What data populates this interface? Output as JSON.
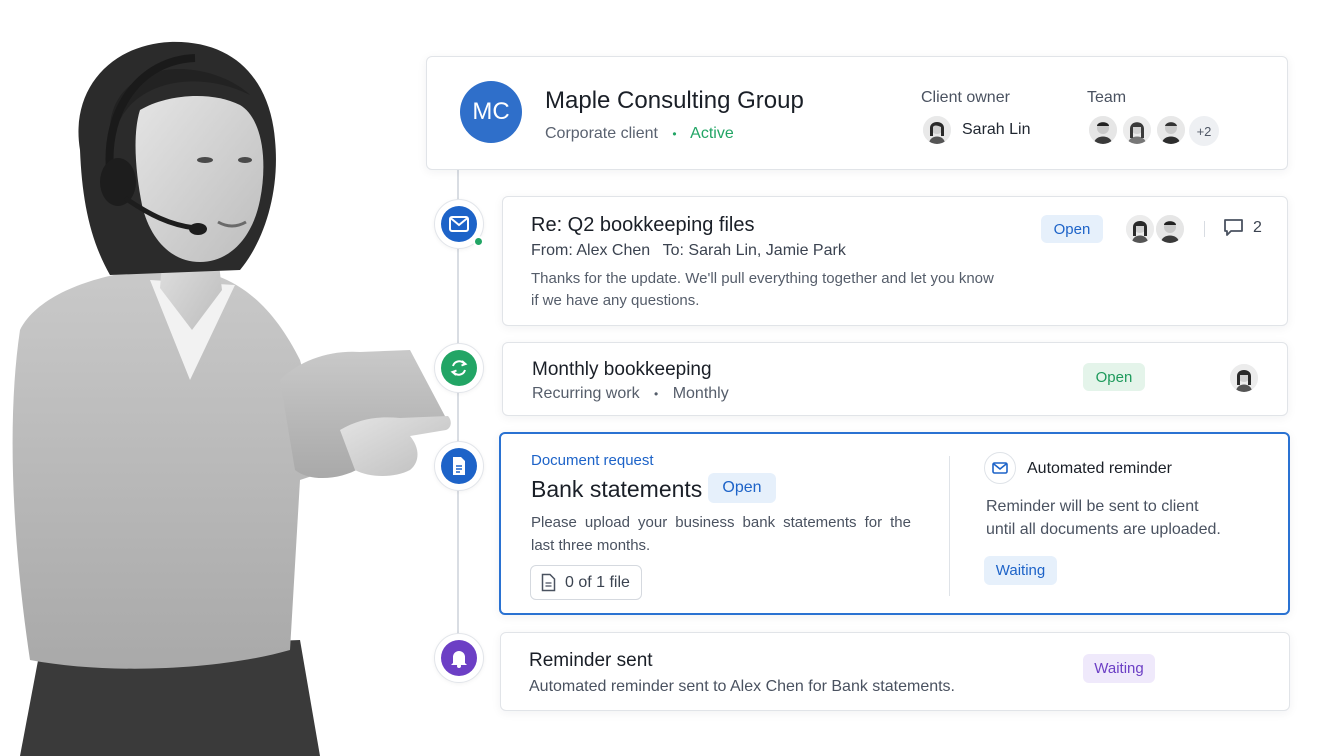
{
  "client": {
    "initials": "MC",
    "name": "Maple Consulting Group",
    "type": "Corporate client",
    "separator": "•",
    "status": "Active",
    "owner_label": "Client owner",
    "owner_name": "Sarah Lin",
    "team_label": "Team",
    "team_extra": "+2"
  },
  "email_item": {
    "icon": "mail-icon",
    "subject": "Re: Q2 bookkeeping files",
    "from_label": "From:",
    "from_name": "Alex Chen",
    "to_label": "To:",
    "to_names": "Sarah Lin, Jamie Park",
    "preview": "Thanks for the update. We'll pull everything together and let you know if we have any questions.",
    "status": "Open",
    "comment_count": "2"
  },
  "recurring_item": {
    "icon": "refresh-icon",
    "title": "Monthly bookkeeping",
    "kind": "Recurring work",
    "separator": "•",
    "frequency": "Monthly",
    "status": "Open"
  },
  "document_item": {
    "icon": "document-icon",
    "eyebrow": "Document request",
    "title": "Bank statements",
    "status": "Open",
    "description": "Please upload your business bank statements for the last three months.",
    "file_count": "0 of 1 file",
    "reminder_title": "Automated reminder",
    "reminder_text": "Reminder will be sent to client until all documents are uploaded.",
    "reminder_status": "Waiting"
  },
  "reminder_item": {
    "icon": "bell-icon",
    "title": "Reminder sent",
    "description": "Automated reminder sent to Alex Chen for Bank statements.",
    "status": "Waiting"
  },
  "colors": {
    "primary_blue": "#1d63c8",
    "open_blue_bg": "#e6f0fb",
    "green": "#22a565",
    "open_green_bg": "#e4f4ea",
    "purple": "#6c3fc5",
    "waiting_purple_bg": "#efe9fb",
    "waiting_blue_bg": "#e6f0fb"
  }
}
